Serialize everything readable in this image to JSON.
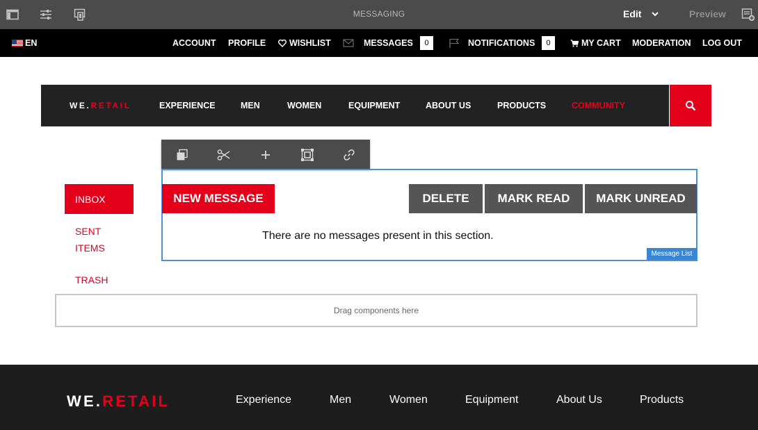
{
  "editor": {
    "title": "MESSAGING",
    "mode": "Edit",
    "preview": "Preview"
  },
  "account_bar": {
    "language": "EN",
    "account": "ACCOUNT",
    "profile": "PROFILE",
    "wishlist": "WISHLIST",
    "messages": "MESSAGES",
    "messages_count": "0",
    "notifications": "NOTIFICATIONS",
    "notifications_count": "0",
    "cart": "MY CART",
    "moderation": "MODERATION",
    "logout": "LOG OUT"
  },
  "site_nav": {
    "logo_white": "WE.",
    "logo_red": "RETAIL",
    "items": [
      "EXPERIENCE",
      "MEN",
      "WOMEN",
      "EQUIPMENT",
      "ABOUT US",
      "PRODUCTS",
      "COMMUNITY"
    ]
  },
  "sidebar": {
    "inbox": "INBOX",
    "sent_line1": "SENT",
    "sent_line2": "ITEMS",
    "trash": "TRASH"
  },
  "message_list": {
    "new_message": "NEW MESSAGE",
    "delete": "DELETE",
    "mark_read": "MARK READ",
    "mark_unread": "MARK UNREAD",
    "empty_text": "There are no messages present in this section.",
    "component_label": "Message List"
  },
  "dropzone": {
    "text": "Drag components here"
  },
  "footer": {
    "logo_white": "WE.",
    "logo_red": "RETAIL",
    "items": [
      "Experience",
      "Men",
      "Women",
      "Equipment",
      "About Us",
      "Products"
    ]
  },
  "colors": {
    "brand_red": "#e4001b",
    "editor_bar": "#4b4b4b",
    "selection_blue": "#4a8fd7"
  },
  "icons": {
    "editor_left": [
      "side-panel-icon",
      "properties-icon",
      "emulator-icon"
    ],
    "editor_right": "annotations-icon",
    "toolbar": [
      "copy-icon",
      "cut-icon",
      "insert-icon",
      "group-icon",
      "link-icon"
    ]
  }
}
